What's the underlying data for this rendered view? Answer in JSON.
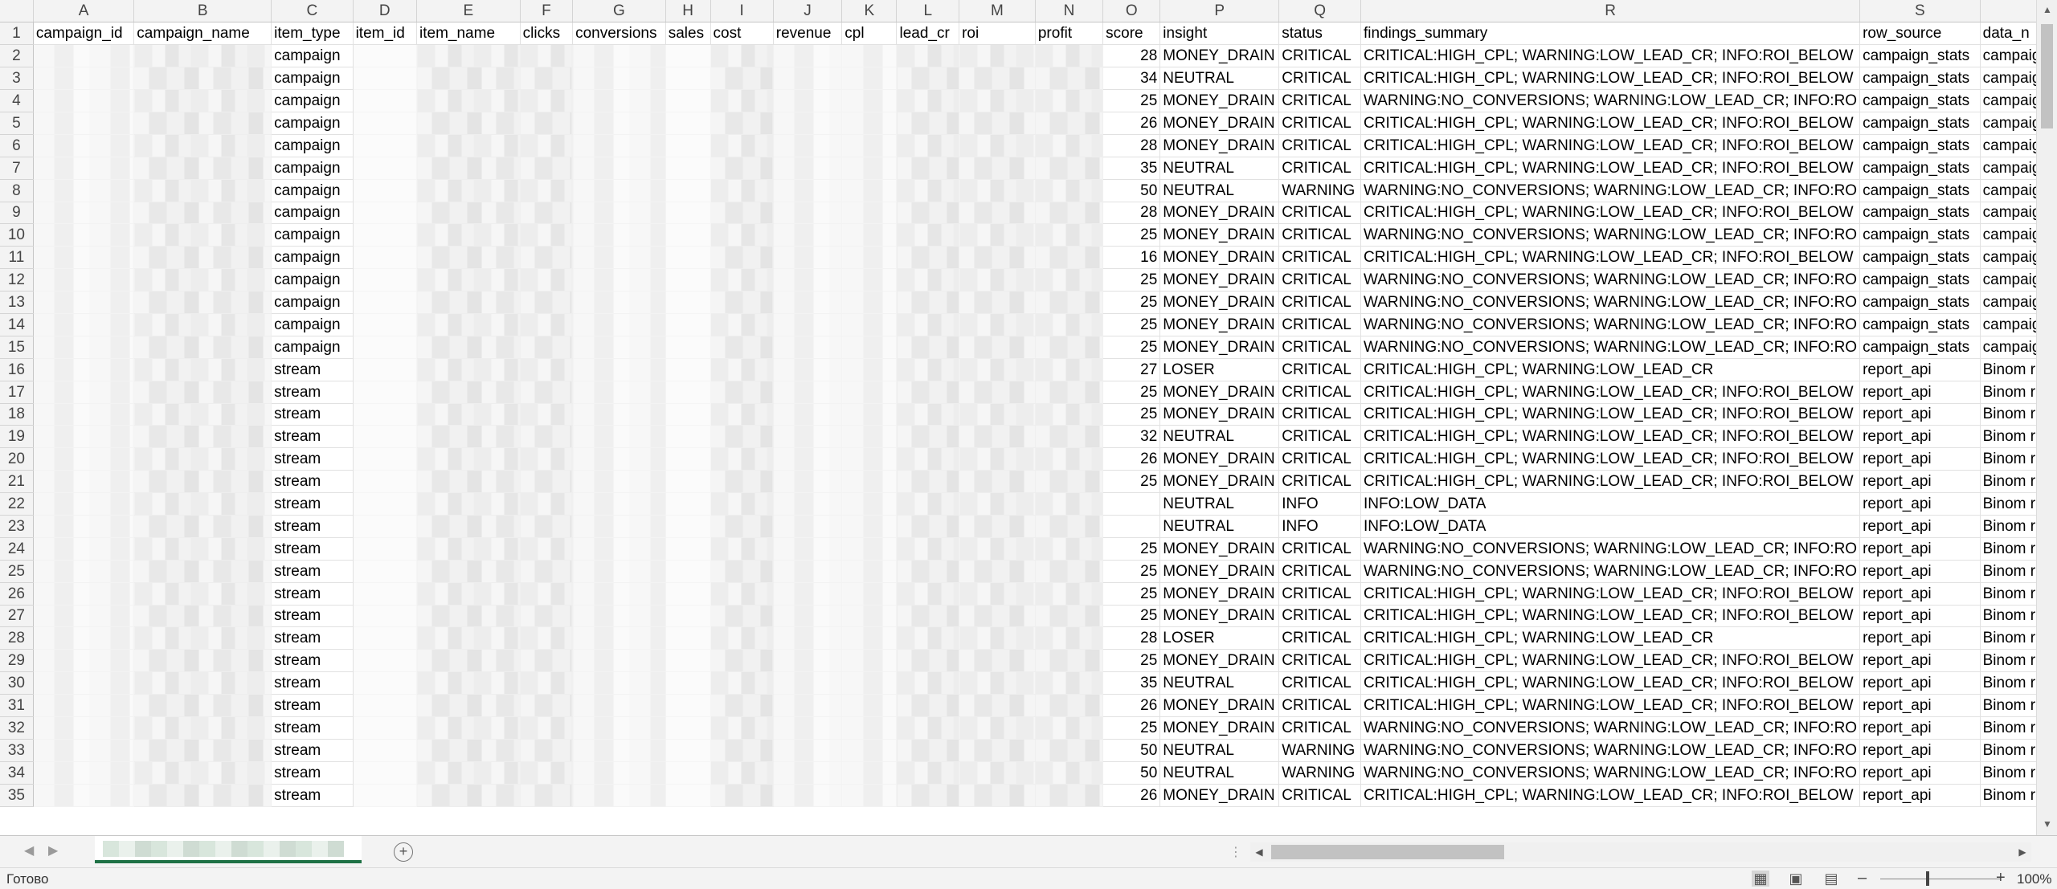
{
  "sheet": {
    "columns": [
      "A",
      "B",
      "C",
      "D",
      "E",
      "F",
      "G",
      "H",
      "I",
      "J",
      "K",
      "L",
      "M",
      "N",
      "O",
      "P",
      "Q",
      "R",
      "S",
      ""
    ],
    "headers": [
      "campaign_id",
      "campaign_name",
      "item_type",
      "item_id",
      "item_name",
      "clicks",
      "conversions",
      "sales",
      "cost",
      "revenue",
      "cpl",
      "lead_cr",
      "roi",
      "profit",
      "score",
      "insight",
      "status",
      "findings_summary",
      "row_source",
      "data_n"
    ],
    "rows": [
      {
        "n": "1"
      },
      {
        "n": "2",
        "c": "campaign",
        "o": "28",
        "p": "MONEY_DRAIN",
        "q": "CRITICAL",
        "r": "CRITICAL:HIGH_CPL; WARNING:LOW_LEAD_CR; INFO:ROI_BELOW",
        "s": "campaign_stats",
        "t": "campaig"
      },
      {
        "n": "3",
        "c": "campaign",
        "o": "34",
        "p": "NEUTRAL",
        "q": "CRITICAL",
        "r": "CRITICAL:HIGH_CPL; WARNING:LOW_LEAD_CR; INFO:ROI_BELOW",
        "s": "campaign_stats",
        "t": "campaig"
      },
      {
        "n": "4",
        "c": "campaign",
        "o": "25",
        "p": "MONEY_DRAIN",
        "q": "CRITICAL",
        "r": "WARNING:NO_CONVERSIONS; WARNING:LOW_LEAD_CR; INFO:RO",
        "s": "campaign_stats",
        "t": "campaig"
      },
      {
        "n": "5",
        "c": "campaign",
        "o": "26",
        "p": "MONEY_DRAIN",
        "q": "CRITICAL",
        "r": "CRITICAL:HIGH_CPL; WARNING:LOW_LEAD_CR; INFO:ROI_BELOW",
        "s": "campaign_stats",
        "t": "campaig"
      },
      {
        "n": "6",
        "c": "campaign",
        "o": "28",
        "p": "MONEY_DRAIN",
        "q": "CRITICAL",
        "r": "CRITICAL:HIGH_CPL; WARNING:LOW_LEAD_CR; INFO:ROI_BELOW",
        "s": "campaign_stats",
        "t": "campaig"
      },
      {
        "n": "7",
        "c": "campaign",
        "o": "35",
        "p": "NEUTRAL",
        "q": "CRITICAL",
        "r": "CRITICAL:HIGH_CPL; WARNING:LOW_LEAD_CR; INFO:ROI_BELOW",
        "s": "campaign_stats",
        "t": "campaig"
      },
      {
        "n": "8",
        "c": "campaign",
        "o": "50",
        "p": "NEUTRAL",
        "q": "WARNING",
        "r": "WARNING:NO_CONVERSIONS; WARNING:LOW_LEAD_CR; INFO:RO",
        "s": "campaign_stats",
        "t": "campaig"
      },
      {
        "n": "9",
        "c": "campaign",
        "o": "28",
        "p": "MONEY_DRAIN",
        "q": "CRITICAL",
        "r": "CRITICAL:HIGH_CPL; WARNING:LOW_LEAD_CR; INFO:ROI_BELOW",
        "s": "campaign_stats",
        "t": "campaig"
      },
      {
        "n": "10",
        "c": "campaign",
        "o": "25",
        "p": "MONEY_DRAIN",
        "q": "CRITICAL",
        "r": "WARNING:NO_CONVERSIONS; WARNING:LOW_LEAD_CR; INFO:RO",
        "s": "campaign_stats",
        "t": "campaig"
      },
      {
        "n": "11",
        "c": "campaign",
        "o": "16",
        "p": "MONEY_DRAIN",
        "q": "CRITICAL",
        "r": "CRITICAL:HIGH_CPL; WARNING:LOW_LEAD_CR; INFO:ROI_BELOW",
        "s": "campaign_stats",
        "t": "campaig"
      },
      {
        "n": "12",
        "c": "campaign",
        "o": "25",
        "p": "MONEY_DRAIN",
        "q": "CRITICAL",
        "r": "WARNING:NO_CONVERSIONS; WARNING:LOW_LEAD_CR; INFO:RO",
        "s": "campaign_stats",
        "t": "campaig"
      },
      {
        "n": "13",
        "c": "campaign",
        "o": "25",
        "p": "MONEY_DRAIN",
        "q": "CRITICAL",
        "r": "WARNING:NO_CONVERSIONS; WARNING:LOW_LEAD_CR; INFO:RO",
        "s": "campaign_stats",
        "t": "campaig"
      },
      {
        "n": "14",
        "c": "campaign",
        "o": "25",
        "p": "MONEY_DRAIN",
        "q": "CRITICAL",
        "r": "WARNING:NO_CONVERSIONS; WARNING:LOW_LEAD_CR; INFO:RO",
        "s": "campaign_stats",
        "t": "campaig"
      },
      {
        "n": "15",
        "c": "campaign",
        "o": "25",
        "p": "MONEY_DRAIN",
        "q": "CRITICAL",
        "r": "WARNING:NO_CONVERSIONS; WARNING:LOW_LEAD_CR; INFO:RO",
        "s": "campaign_stats",
        "t": "campaig"
      },
      {
        "n": "16",
        "c": "stream",
        "o": "27",
        "p": "LOSER",
        "q": "CRITICAL",
        "r": "CRITICAL:HIGH_CPL; WARNING:LOW_LEAD_CR",
        "s": "report_api",
        "t": "Binom r"
      },
      {
        "n": "17",
        "c": "stream",
        "o": "25",
        "p": "MONEY_DRAIN",
        "q": "CRITICAL",
        "r": "CRITICAL:HIGH_CPL; WARNING:LOW_LEAD_CR; INFO:ROI_BELOW",
        "s": "report_api",
        "t": "Binom r"
      },
      {
        "n": "18",
        "c": "stream",
        "o": "25",
        "p": "MONEY_DRAIN",
        "q": "CRITICAL",
        "r": "CRITICAL:HIGH_CPL; WARNING:LOW_LEAD_CR; INFO:ROI_BELOW",
        "s": "report_api",
        "t": "Binom r"
      },
      {
        "n": "19",
        "c": "stream",
        "o": "32",
        "p": "NEUTRAL",
        "q": "CRITICAL",
        "r": "CRITICAL:HIGH_CPL; WARNING:LOW_LEAD_CR; INFO:ROI_BELOW",
        "s": "report_api",
        "t": "Binom r"
      },
      {
        "n": "20",
        "c": "stream",
        "o": "26",
        "p": "MONEY_DRAIN",
        "q": "CRITICAL",
        "r": "CRITICAL:HIGH_CPL; WARNING:LOW_LEAD_CR; INFO:ROI_BELOW",
        "s": "report_api",
        "t": "Binom r"
      },
      {
        "n": "21",
        "c": "stream",
        "o": "25",
        "p": "MONEY_DRAIN",
        "q": "CRITICAL",
        "r": "CRITICAL:HIGH_CPL; WARNING:LOW_LEAD_CR; INFO:ROI_BELOW",
        "s": "report_api",
        "t": "Binom r"
      },
      {
        "n": "22",
        "c": "stream",
        "o": "",
        "p": "NEUTRAL",
        "q": "INFO",
        "r": "INFO:LOW_DATA",
        "s": "report_api",
        "t": "Binom r"
      },
      {
        "n": "23",
        "c": "stream",
        "o": "",
        "p": "NEUTRAL",
        "q": "INFO",
        "r": "INFO:LOW_DATA",
        "s": "report_api",
        "t": "Binom r"
      },
      {
        "n": "24",
        "c": "stream",
        "o": "25",
        "p": "MONEY_DRAIN",
        "q": "CRITICAL",
        "r": "WARNING:NO_CONVERSIONS; WARNING:LOW_LEAD_CR; INFO:RO",
        "s": "report_api",
        "t": "Binom r"
      },
      {
        "n": "25",
        "c": "stream",
        "o": "25",
        "p": "MONEY_DRAIN",
        "q": "CRITICAL",
        "r": "WARNING:NO_CONVERSIONS; WARNING:LOW_LEAD_CR; INFO:RO",
        "s": "report_api",
        "t": "Binom r"
      },
      {
        "n": "26",
        "c": "stream",
        "o": "25",
        "p": "MONEY_DRAIN",
        "q": "CRITICAL",
        "r": "CRITICAL:HIGH_CPL; WARNING:LOW_LEAD_CR; INFO:ROI_BELOW",
        "s": "report_api",
        "t": "Binom r"
      },
      {
        "n": "27",
        "c": "stream",
        "o": "25",
        "p": "MONEY_DRAIN",
        "q": "CRITICAL",
        "r": "CRITICAL:HIGH_CPL; WARNING:LOW_LEAD_CR; INFO:ROI_BELOW",
        "s": "report_api",
        "t": "Binom r"
      },
      {
        "n": "28",
        "c": "stream",
        "o": "28",
        "p": "LOSER",
        "q": "CRITICAL",
        "r": "CRITICAL:HIGH_CPL; WARNING:LOW_LEAD_CR",
        "s": "report_api",
        "t": "Binom r"
      },
      {
        "n": "29",
        "c": "stream",
        "o": "25",
        "p": "MONEY_DRAIN",
        "q": "CRITICAL",
        "r": "CRITICAL:HIGH_CPL; WARNING:LOW_LEAD_CR; INFO:ROI_BELOW",
        "s": "report_api",
        "t": "Binom r"
      },
      {
        "n": "30",
        "c": "stream",
        "o": "35",
        "p": "NEUTRAL",
        "q": "CRITICAL",
        "r": "CRITICAL:HIGH_CPL; WARNING:LOW_LEAD_CR; INFO:ROI_BELOW",
        "s": "report_api",
        "t": "Binom r"
      },
      {
        "n": "31",
        "c": "stream",
        "o": "26",
        "p": "MONEY_DRAIN",
        "q": "CRITICAL",
        "r": "CRITICAL:HIGH_CPL; WARNING:LOW_LEAD_CR; INFO:ROI_BELOW",
        "s": "report_api",
        "t": "Binom r"
      },
      {
        "n": "32",
        "c": "stream",
        "o": "25",
        "p": "MONEY_DRAIN",
        "q": "CRITICAL",
        "r": "WARNING:NO_CONVERSIONS; WARNING:LOW_LEAD_CR; INFO:RO",
        "s": "report_api",
        "t": "Binom r"
      },
      {
        "n": "33",
        "c": "stream",
        "o": "50",
        "p": "NEUTRAL",
        "q": "WARNING",
        "r": "WARNING:NO_CONVERSIONS; WARNING:LOW_LEAD_CR; INFO:RO",
        "s": "report_api",
        "t": "Binom r"
      },
      {
        "n": "34",
        "c": "stream",
        "o": "50",
        "p": "NEUTRAL",
        "q": "WARNING",
        "r": "WARNING:NO_CONVERSIONS; WARNING:LOW_LEAD_CR; INFO:RO",
        "s": "report_api",
        "t": "Binom r"
      },
      {
        "n": "35",
        "c": "stream",
        "o": "26",
        "p": "MONEY_DRAIN",
        "q": "CRITICAL",
        "r": "CRITICAL:HIGH_CPL; WARNING:LOW_LEAD_CR; INFO:ROI_BELOW",
        "s": "report_api",
        "t": "Binom r"
      }
    ]
  },
  "status_bar": {
    "ready_text": "Готово",
    "zoom": "100%"
  },
  "colors": {
    "accent": "#1e7145",
    "header_bg": "#f3f3f3",
    "grid_line": "#e1e1e1"
  }
}
